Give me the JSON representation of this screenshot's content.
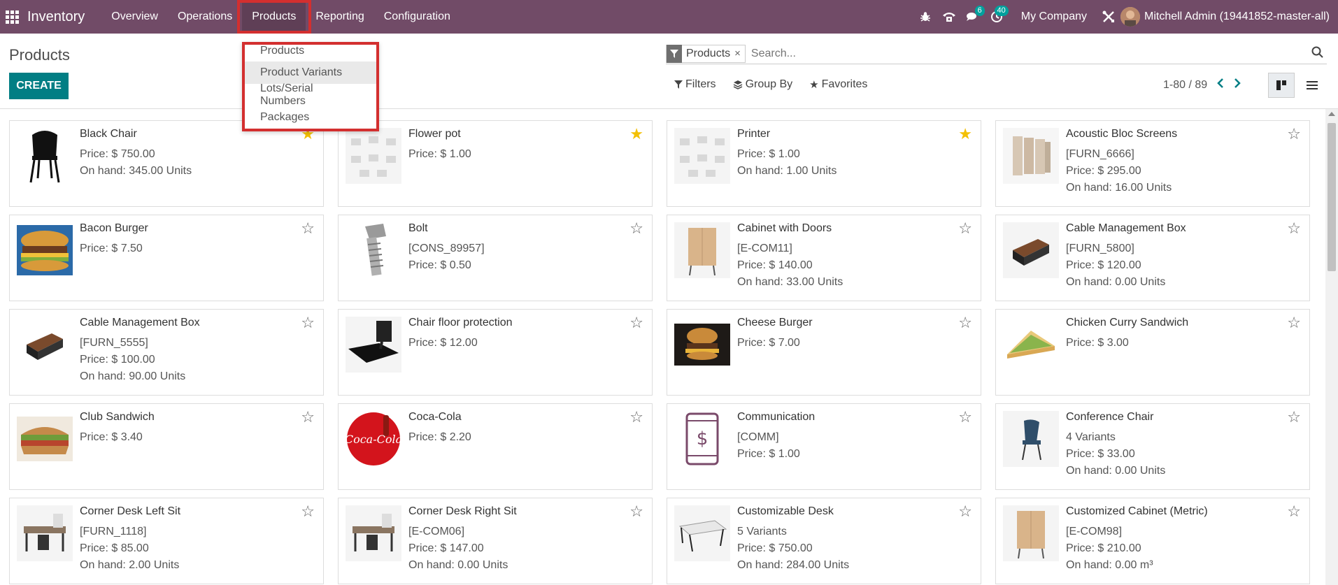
{
  "app": {
    "name": "Inventory",
    "menu": [
      "Overview",
      "Operations",
      "Products",
      "Reporting",
      "Configuration"
    ],
    "active_menu": "Products",
    "messages_badge": "6",
    "activities_badge": "40",
    "company": "My Company",
    "user": "Mitchell Admin (19441852-master-all)",
    "brand_color": "#714B67"
  },
  "dropdown": {
    "items": [
      "Products",
      "Product Variants",
      "Lots/Serial Numbers",
      "Packages"
    ],
    "highlighted": "Product Variants"
  },
  "control": {
    "title": "Products",
    "create_label": "CREATE",
    "facet": "Products",
    "search_placeholder": "Search...",
    "filters": "Filters",
    "group_by": "Group By",
    "favorites": "Favorites",
    "pager": "1-80 / 89"
  },
  "products": [
    {
      "name": "Black Chair",
      "lines": [
        "Price: $ 750.00",
        "On hand: 345.00 Units"
      ],
      "fav": true
    },
    {
      "name": "Flower pot",
      "lines": [
        "Price: $ 1.00"
      ],
      "fav": true
    },
    {
      "name": "Printer",
      "lines": [
        "Price: $ 1.00",
        "On hand: 1.00 Units"
      ],
      "fav": true
    },
    {
      "name": "Acoustic Bloc Screens",
      "lines": [
        "[FURN_6666]",
        "Price: $ 295.00",
        "On hand: 16.00 Units"
      ],
      "fav": false
    },
    {
      "name": "Bacon Burger",
      "lines": [
        "Price: $ 7.50"
      ],
      "fav": false
    },
    {
      "name": "Bolt",
      "lines": [
        "[CONS_89957]",
        "Price: $ 0.50"
      ],
      "fav": false
    },
    {
      "name": "Cabinet with Doors",
      "lines": [
        "[E-COM11]",
        "Price: $ 140.00",
        "On hand: 33.00 Units"
      ],
      "fav": false
    },
    {
      "name": "Cable Management Box",
      "lines": [
        "[FURN_5800]",
        "Price: $ 120.00",
        "On hand: 0.00 Units"
      ],
      "fav": false
    },
    {
      "name": "Cable Management Box",
      "lines": [
        "[FURN_5555]",
        "Price: $ 100.00",
        "On hand: 90.00 Units"
      ],
      "fav": false
    },
    {
      "name": "Chair floor protection",
      "lines": [
        "Price: $ 12.00"
      ],
      "fav": false
    },
    {
      "name": "Cheese Burger",
      "lines": [
        "Price: $ 7.00"
      ],
      "fav": false
    },
    {
      "name": "Chicken Curry Sandwich",
      "lines": [
        "Price: $ 3.00"
      ],
      "fav": false
    },
    {
      "name": "Club Sandwich",
      "lines": [
        "Price: $ 3.40"
      ],
      "fav": false
    },
    {
      "name": "Coca-Cola",
      "lines": [
        "Price: $ 2.20"
      ],
      "fav": false
    },
    {
      "name": "Communication",
      "lines": [
        "[COMM]",
        "Price: $ 1.00"
      ],
      "fav": false
    },
    {
      "name": "Conference Chair",
      "lines": [
        "4 Variants",
        "Price: $ 33.00",
        "On hand: 0.00 Units"
      ],
      "fav": false
    },
    {
      "name": "Corner Desk Left Sit",
      "lines": [
        "[FURN_1118]",
        "Price: $ 85.00",
        "On hand: 2.00 Units"
      ],
      "fav": false
    },
    {
      "name": "Corner Desk Right Sit",
      "lines": [
        "[E-COM06]",
        "Price: $ 147.00",
        "On hand: 0.00 Units"
      ],
      "fav": false
    },
    {
      "name": "Customizable Desk",
      "lines": [
        "5 Variants",
        "Price: $ 750.00",
        "On hand: 284.00 Units"
      ],
      "fav": false
    },
    {
      "name": "Customized Cabinet (Metric)",
      "lines": [
        "[E-COM98]",
        "Price: $ 210.00",
        "On hand: 0.00 m³"
      ],
      "fav": false
    }
  ]
}
